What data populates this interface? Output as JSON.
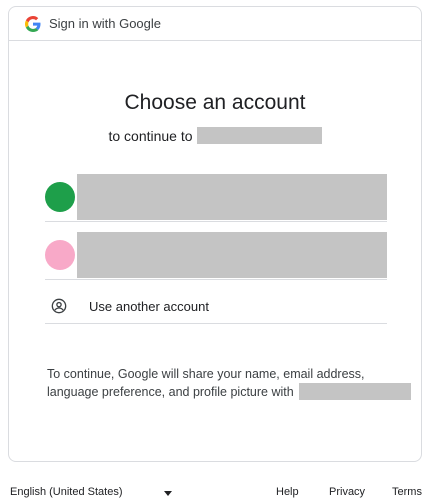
{
  "header": {
    "title": "Sign in with Google",
    "logo_icon": "google-g-icon"
  },
  "main": {
    "title": "Choose an account",
    "subtitle_prefix": "to continue to",
    "accounts": [
      {
        "avatar_color": "#1e9f4a"
      },
      {
        "avatar_color": "#f8a9c8"
      }
    ],
    "use_another_label": "Use another account",
    "use_another_icon": "account-circle-icon",
    "disclaimer_text": "To continue, Google will share your name, email address, language preference, and profile picture with"
  },
  "footer": {
    "language": "English (United States)",
    "help": "Help",
    "privacy": "Privacy",
    "terms": "Terms"
  }
}
